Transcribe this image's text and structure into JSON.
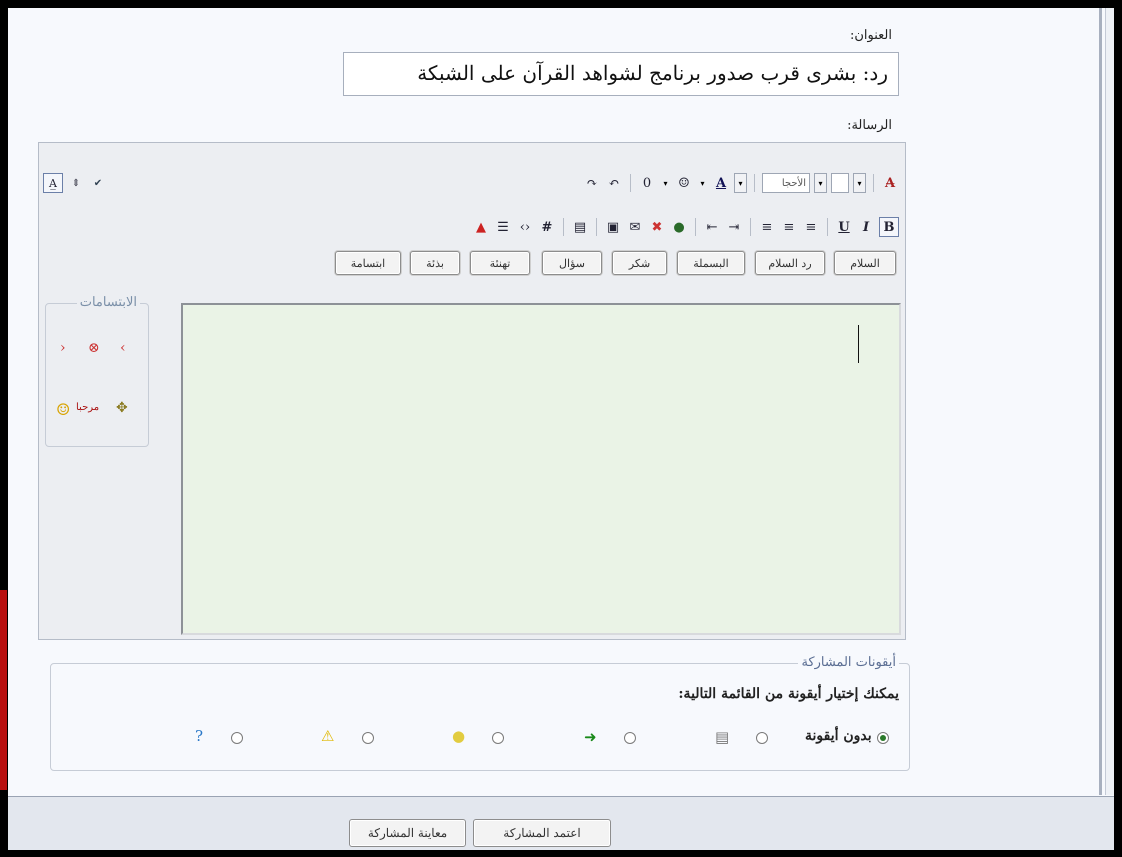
{
  "form": {
    "subject_label": "العنوان:",
    "subject_value": "رد: بشرى قرب صدور برنامج لشواهد القرآن على الشبكة",
    "message_label": "الرسالة:"
  },
  "toolbar": {
    "font_select": "الأحجا",
    "size_select": ""
  },
  "quick_buttons": [
    "السلام",
    "رد السلام",
    "البسملة",
    "شكر",
    "سؤال",
    "تهنئة",
    "بذئة",
    "ابتسامة"
  ],
  "smilies": {
    "legend": "الابتسامات",
    "badge_text": "مرحبا"
  },
  "post_icons": {
    "legend": "أيقونات المشاركة",
    "hint": "يمكنك إختيار أيقونة من القائمة التالية:",
    "none_label": "بدون أيقونة",
    "icons": [
      "document-icon",
      "green-arrow-icon",
      "lightbulb-icon",
      "warning-icon",
      "question-icon"
    ]
  },
  "footer": {
    "submit_label": "اعتمد المشاركة",
    "preview_label": "معاينة المشاركة"
  },
  "colors": {
    "editor_bg": "#eaf3e6",
    "frame_bg": "#f7f9fd",
    "legend_text": "#5b6e93"
  }
}
